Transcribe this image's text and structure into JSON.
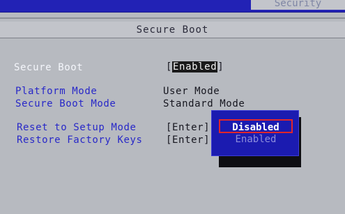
{
  "tabs": {
    "security": "Security"
  },
  "heading": "Secure Boot",
  "secure_boot": {
    "label": "Secure Boot",
    "value": "Enabled"
  },
  "platform_mode": {
    "label": "Platform Mode",
    "value": "User Mode"
  },
  "secure_boot_mode": {
    "label": "Secure Boot Mode",
    "value": "Standard Mode"
  },
  "reset_setup": {
    "label": "Reset to Setup Mode",
    "value": "[Enter]"
  },
  "restore_keys": {
    "label": "Restore Factory Keys",
    "value": "[Enter]"
  },
  "popup": {
    "options": [
      "Disabled",
      "Enabled"
    ],
    "selected": "Disabled"
  },
  "colors": {
    "bg": "#b7bac0",
    "menu_blue": "#2222b5",
    "highlight": "#e0262a"
  }
}
